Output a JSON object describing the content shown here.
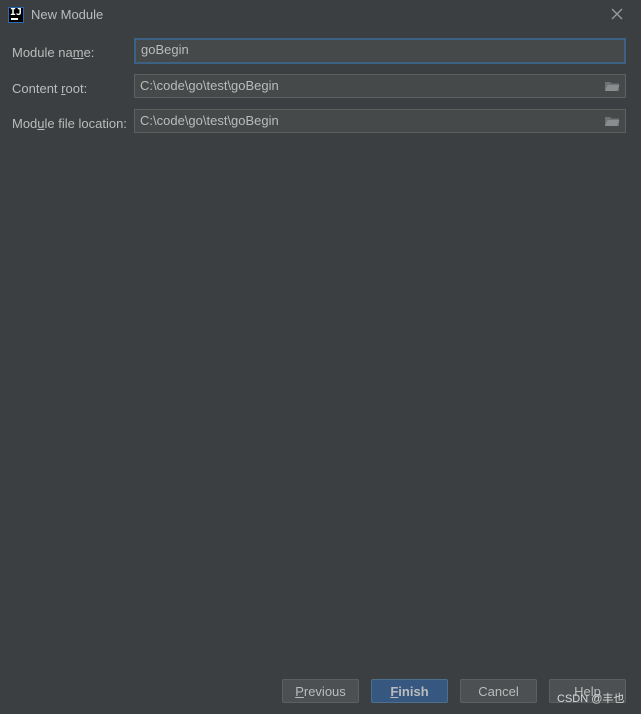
{
  "window": {
    "title": "New Module",
    "app_icon": "intellij-icon"
  },
  "form": {
    "module_name": {
      "label_pre": "Module na",
      "label_mnemonic": "m",
      "label_post": "e:",
      "value": "goBegin"
    },
    "content_root": {
      "label_pre": "Content ",
      "label_mnemonic": "r",
      "label_post": "oot:",
      "value": "C:\\code\\go\\test\\goBegin"
    },
    "module_file_location": {
      "label_pre": "Mod",
      "label_mnemonic": "u",
      "label_post": "le file location:",
      "value": "C:\\code\\go\\test\\goBegin"
    }
  },
  "buttons": {
    "previous": {
      "mnemonic": "P",
      "rest": "revious"
    },
    "finish": {
      "mnemonic": "F",
      "rest": "inish"
    },
    "cancel": "Cancel",
    "help": "Help"
  },
  "watermark": "CSDN @丰也",
  "colors": {
    "background": "#3c3f41",
    "field_bg": "#45494a",
    "focus_border": "#3d6185",
    "primary_button": "#365880"
  }
}
